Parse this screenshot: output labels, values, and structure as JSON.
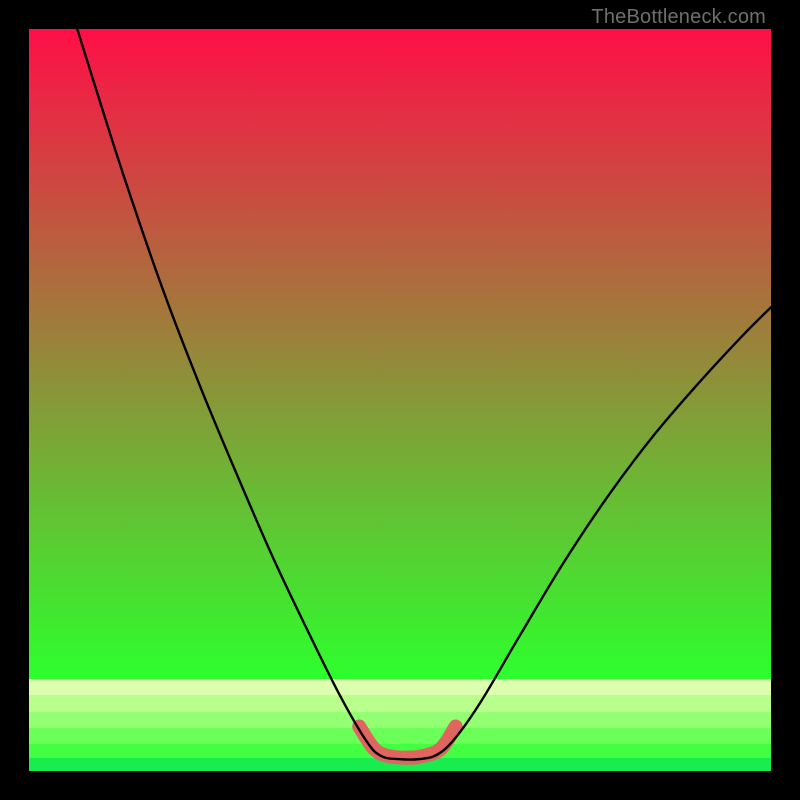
{
  "watermark": "TheBottleneck.com",
  "chart_data": {
    "type": "line",
    "title": "",
    "xlabel": "",
    "ylabel": "",
    "xlim": [
      0,
      100
    ],
    "ylim": [
      0,
      100
    ],
    "grid": false,
    "legend": false,
    "gradient_bands": [
      {
        "from_pct": 0.0,
        "to_pct": 0.876,
        "from_color": "#ff0f47",
        "to_color": "#2dff2d"
      },
      {
        "from_pct": 0.876,
        "to_pct": 0.898,
        "color": "#dbffae"
      },
      {
        "from_pct": 0.898,
        "to_pct": 0.92,
        "color": "#b9ff8d"
      },
      {
        "from_pct": 0.92,
        "to_pct": 0.942,
        "color": "#93ff73"
      },
      {
        "from_pct": 0.942,
        "to_pct": 0.964,
        "color": "#6aff59"
      },
      {
        "from_pct": 0.964,
        "to_pct": 0.983,
        "color": "#42ff42"
      },
      {
        "from_pct": 0.983,
        "to_pct": 1.0,
        "color": "#18ec4e"
      }
    ],
    "series": [
      {
        "name": "bottleneck-curve",
        "stroke": "#000000",
        "stroke_width": 2.4,
        "points": [
          {
            "x": 6.5,
            "y": 100.0
          },
          {
            "x": 9.0,
            "y": 92.0
          },
          {
            "x": 13.0,
            "y": 79.5
          },
          {
            "x": 18.0,
            "y": 65.0
          },
          {
            "x": 23.0,
            "y": 52.0
          },
          {
            "x": 28.0,
            "y": 40.0
          },
          {
            "x": 33.0,
            "y": 28.5
          },
          {
            "x": 38.0,
            "y": 18.0
          },
          {
            "x": 42.0,
            "y": 10.0
          },
          {
            "x": 45.5,
            "y": 4.0
          },
          {
            "x": 47.5,
            "y": 2.0
          },
          {
            "x": 50.0,
            "y": 1.6
          },
          {
            "x": 52.5,
            "y": 1.6
          },
          {
            "x": 55.0,
            "y": 2.2
          },
          {
            "x": 57.5,
            "y": 4.5
          },
          {
            "x": 61.0,
            "y": 9.5
          },
          {
            "x": 66.0,
            "y": 18.0
          },
          {
            "x": 72.0,
            "y": 28.0
          },
          {
            "x": 78.0,
            "y": 37.0
          },
          {
            "x": 84.0,
            "y": 45.0
          },
          {
            "x": 90.0,
            "y": 52.0
          },
          {
            "x": 96.0,
            "y": 58.5
          },
          {
            "x": 100.0,
            "y": 62.5
          }
        ]
      },
      {
        "name": "highlight-band",
        "stroke": "#e0645f",
        "stroke_width": 14,
        "points": [
          {
            "x": 44.5,
            "y": 6.0
          },
          {
            "x": 46.5,
            "y": 3.0
          },
          {
            "x": 48.5,
            "y": 2.0
          },
          {
            "x": 51.0,
            "y": 1.8
          },
          {
            "x": 53.0,
            "y": 2.0
          },
          {
            "x": 55.5,
            "y": 3.0
          },
          {
            "x": 57.5,
            "y": 6.0
          }
        ]
      }
    ]
  }
}
